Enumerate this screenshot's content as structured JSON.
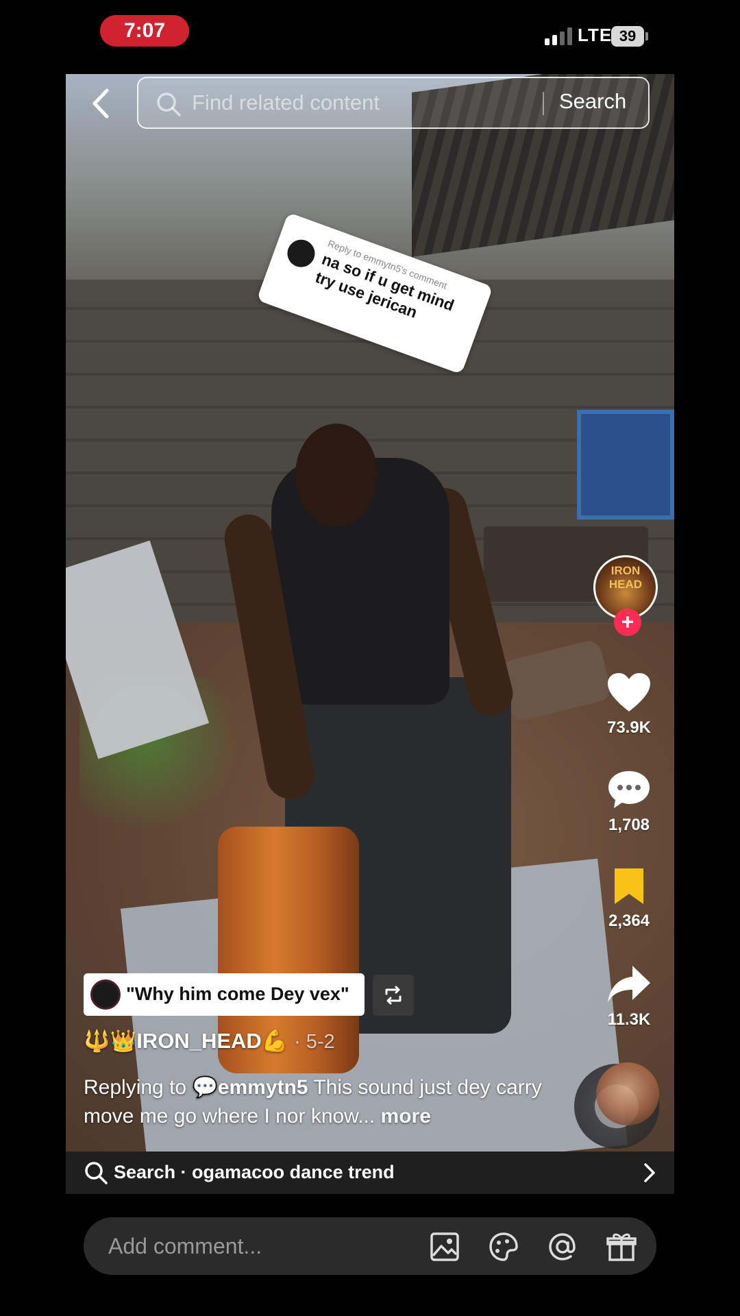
{
  "status_bar": {
    "time": "7:07",
    "network": "LTE",
    "battery": "39",
    "time_pill_color": "#d0232f"
  },
  "top_bar": {
    "search_placeholder": "Find related content",
    "search_button": "Search"
  },
  "reply_sticker": {
    "title": "Reply to emmytn5's comment",
    "text": "na so if u get mind try use jerican"
  },
  "creator_avatar": {
    "label": "IRON HEAD"
  },
  "actions": {
    "likes": "73.9K",
    "comments": "1,708",
    "saves": "2,364",
    "shares": "11.3K",
    "save_color": "#f7c316",
    "follow_color": "#fe2c55"
  },
  "sound": {
    "title": "\"Why him come Dey vex\""
  },
  "post": {
    "username": "🔱👑IRON_HEAD💪",
    "date": "· 5-2",
    "caption_prefix": "Replying to",
    "mention": "emmytn5",
    "caption_text": "This sound just dey carry move me go where I nor know...",
    "more": "more"
  },
  "suggestion": {
    "text": "Search · ogamacoo dance trend"
  },
  "comment_bar": {
    "placeholder": "Add comment..."
  }
}
